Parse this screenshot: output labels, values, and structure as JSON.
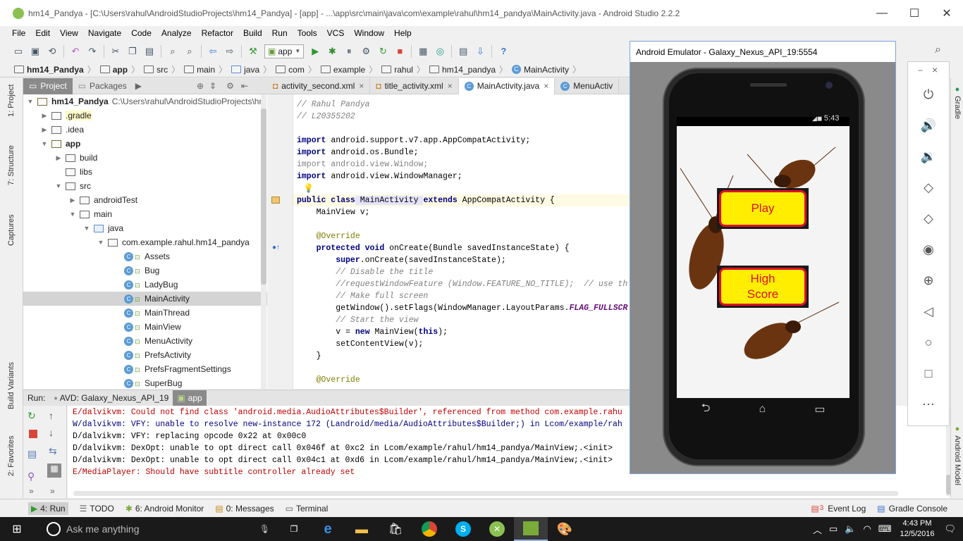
{
  "window": {
    "title": "hm14_Pandya - [C:\\Users\\rahul\\AndroidStudioProjects\\hm14_Pandya] - [app] - ...\\app\\src\\main\\java\\com\\example\\rahul\\hm14_pandya\\MainActivity.java - Android Studio 2.2.2",
    "minimize": "—",
    "maximize": "☐",
    "close": "✕"
  },
  "menu": [
    "File",
    "Edit",
    "View",
    "Navigate",
    "Code",
    "Analyze",
    "Refactor",
    "Build",
    "Run",
    "Tools",
    "VCS",
    "Window",
    "Help"
  ],
  "toolbar": {
    "run_config": "app",
    "help": "?"
  },
  "breadcrumbs": [
    "hm14_Pandya",
    "app",
    "src",
    "main",
    "java",
    "com",
    "example",
    "rahul",
    "hm14_pandya",
    "MainActivity"
  ],
  "left_strip": {
    "project": "1: Project",
    "structure": "7: Structure",
    "captures": "Captures",
    "build_variants": "Build Variants",
    "favorites": "2: Favorites"
  },
  "project_panel": {
    "tabs": [
      "Project",
      "Packages"
    ],
    "root_name": "hm14_Pandya",
    "root_path": "C:\\Users\\rahul\\AndroidStudioProjects\\hm",
    "tree": [
      {
        "label": "hm14_Pandya"
      },
      {
        "label": ".gradle"
      },
      {
        "label": ".idea"
      },
      {
        "label": "app"
      },
      {
        "label": "build"
      },
      {
        "label": "libs"
      },
      {
        "label": "src"
      },
      {
        "label": "androidTest"
      },
      {
        "label": "main"
      },
      {
        "label": "java"
      },
      {
        "label": "com.example.rahul.hm14_pandya"
      },
      {
        "label": "Assets"
      },
      {
        "label": "Bug"
      },
      {
        "label": "LadyBug"
      },
      {
        "label": "MainActivity"
      },
      {
        "label": "MainThread"
      },
      {
        "label": "MainView"
      },
      {
        "label": "MenuActivity"
      },
      {
        "label": "PrefsActivity"
      },
      {
        "label": "PrefsFragmentSettings"
      },
      {
        "label": "SuperBug"
      }
    ]
  },
  "editor_tabs": [
    {
      "label": "activity_second.xml"
    },
    {
      "label": "title_activity.xml"
    },
    {
      "label": "MainActivity.java"
    },
    {
      "label": "MenuActiv"
    }
  ],
  "code": {
    "l1": "// Rahul Pandya",
    "l2": "// L20355202",
    "l3_kw": "import",
    "l3_rest": " android.support.v7.app.AppCompatActivity;",
    "l4_kw": "import",
    "l4_rest": " android.os.Bundle;",
    "l5": "import android.view.Window;",
    "l6_kw": "import",
    "l6_rest": " android.view.WindowManager;",
    "l7_kw": "public class",
    "l7_name": " MainActivity ",
    "l7_kw2": "extends",
    "l7_rest": " AppCompatActivity {",
    "l8": "    MainView v;",
    "l9": "    @Override",
    "l10_kw": "    protected void",
    "l10_rest": " onCreate(Bundle savedInstanceState) {",
    "l11_kw": "        super",
    "l11_rest": ".onCreate(savedInstanceState);",
    "l12": "        // Disable the title",
    "l13": "        //requestWindowFeature (Window.FEATURE_NO_TITLE);  // use th",
    "l14": "        // Make full screen",
    "l15_a": "        getWindow().setFlags(WindowManager.LayoutParams.",
    "l15_b": "FLAG_FULLSCR",
    "l16": "        // Start the view",
    "l17_a": "        v = ",
    "l17_kw": "new",
    "l17_b": " MainView(",
    "l17_kw2": "this",
    "l17_c": ");",
    "l18": "        setContentView(v);",
    "l19": "    }",
    "l20": "    @Override"
  },
  "run_panel": {
    "label": "Run:",
    "tabs": [
      "AVD: Galaxy_Nexus_API_19",
      "app"
    ]
  },
  "console": [
    {
      "text": "E/dalvikvm: Could not find class 'android.media.AudioAttributes$Builder', referenced from method com.example.rahu"
    },
    {
      "text": "W/dalvikvm: VFY: unable to resolve new-instance 172 (Landroid/media/AudioAttributes$Builder;) in Lcom/example/rah"
    },
    {
      "text": "D/dalvikvm: VFY: replacing opcode 0x22 at 0x00c0"
    },
    {
      "text": "D/dalvikvm: DexOpt: unable to opt direct call 0x046f at 0xc2 in Lcom/example/rahul/hm14_pandya/MainView;.<init>"
    },
    {
      "text": "D/dalvikvm: DexOpt: unable to opt direct call 0x04c1 at 0xd6 in Lcom/example/rahul/hm14_pandya/MainView;.<init>"
    },
    {
      "text": "E/MediaPlayer: Should have subtitle controller already set"
    }
  ],
  "status_bar": {
    "run": "4: Run",
    "todo": "TODO",
    "android_monitor": "6: Android Monitor",
    "messages": "0: Messages",
    "terminal": "Terminal",
    "event_log_count": "3",
    "event_log": "Event Log",
    "gradle_console": "Gradle Console"
  },
  "right_strip": {
    "gradle": "Gradle",
    "android_model": "Android Model"
  },
  "emulator": {
    "title": "Android Emulator - Galaxy_Nexus_API_19:5554",
    "status_time": "5:43",
    "play_button": "Play",
    "high_score_line1": "High",
    "high_score_line2": "Score",
    "controls_min": "−",
    "controls_close": "×"
  },
  "taskbar": {
    "search_placeholder": "Ask me anything",
    "time": "4:43 PM",
    "date": "12/5/2016"
  },
  "colors": {
    "game_button_fill": "#ffee00",
    "game_button_border": "#e0102a",
    "taskbar_bg": "#1a1a1a"
  }
}
